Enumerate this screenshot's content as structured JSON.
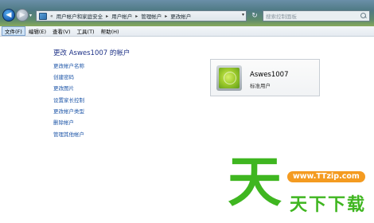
{
  "address_bar": {
    "prefix": "«",
    "crumbs": [
      "用户帐户和家庭安全",
      "用户帐户",
      "管理帐户",
      "更改帐户"
    ]
  },
  "search": {
    "placeholder": "搜索控制面板"
  },
  "menu": [
    "文件(F)",
    "编辑(E)",
    "查看(V)",
    "工具(T)",
    "帮助(H)"
  ],
  "main": {
    "heading": "更改 Aswes1007 的帐户",
    "links": [
      "更改帐户名称",
      "创建密码",
      "更改图片",
      "设置家长控制",
      "更改帐户类型",
      "删除帐户"
    ],
    "other_link": "管理其他帐户"
  },
  "user": {
    "name": "Aswes1007",
    "role": "标准用户"
  },
  "watermark": {
    "glyph": "天",
    "url": "www.TTzip.com",
    "text": "天下下载"
  },
  "colors": {
    "link": "#1e56a8",
    "heading": "#1e3287",
    "watermark_green": "#3fb620",
    "watermark_orange": "#f49b21"
  }
}
